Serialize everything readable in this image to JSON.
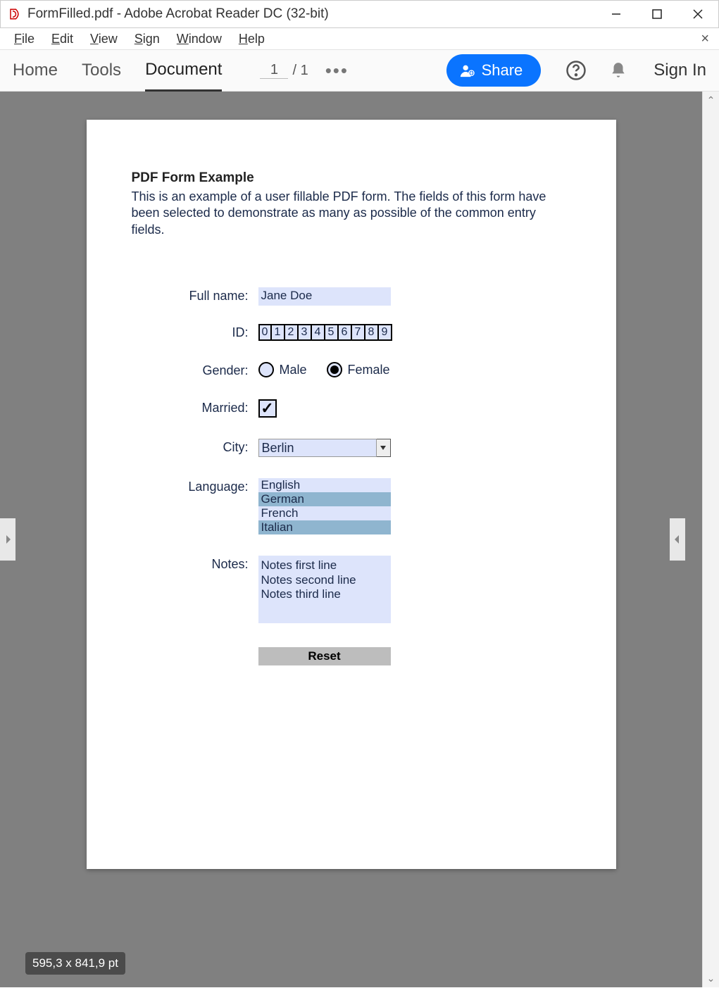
{
  "window": {
    "title": "FormFilled.pdf - Adobe Acrobat Reader DC (32-bit)"
  },
  "menubar": {
    "file": "File",
    "edit": "Edit",
    "view": "View",
    "sign": "Sign",
    "window": "Window",
    "help": "Help"
  },
  "toolbar": {
    "home": "Home",
    "tools": "Tools",
    "document": "Document",
    "page_current": "1",
    "page_sep": "/",
    "page_total": "1",
    "share_label": "Share",
    "signin": "Sign In"
  },
  "doc": {
    "heading": "PDF Form Example",
    "intro": "This is an example of a user fillable PDF form. The fields of this form have been selected to demonstrate as many as possible of the common entry fields.",
    "labels": {
      "fullname": "Full name:",
      "id": "ID:",
      "gender": "Gender:",
      "married": "Married:",
      "city": "City:",
      "language": "Language:",
      "notes": "Notes:"
    },
    "fullname_value": "Jane Doe",
    "id_digits": [
      "0",
      "1",
      "2",
      "3",
      "4",
      "5",
      "6",
      "7",
      "8",
      "9"
    ],
    "gender_options": {
      "male": "Male",
      "female": "Female"
    },
    "gender_value": "female",
    "married_checked": true,
    "city_value": "Berlin",
    "languages": [
      {
        "label": "English",
        "selected": false
      },
      {
        "label": "German",
        "selected": true
      },
      {
        "label": "French",
        "selected": false
      },
      {
        "label": "Italian",
        "selected": true
      }
    ],
    "notes_value": "Notes first line\nNotes second line\nNotes third line",
    "reset_label": "Reset"
  },
  "statusbar": {
    "tooltip": "595,3 x 841,9 pt"
  }
}
